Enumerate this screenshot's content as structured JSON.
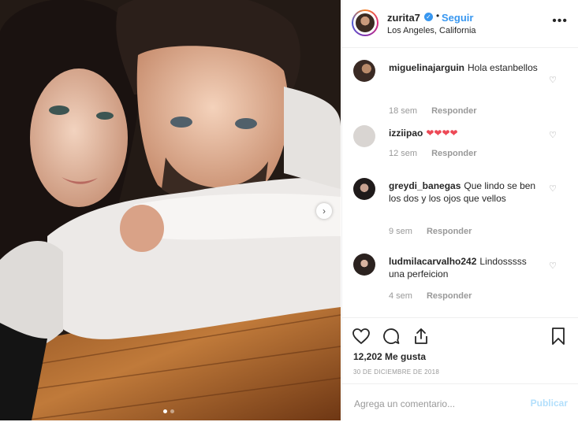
{
  "post": {
    "username": "zurita7",
    "follow_label": "Seguir",
    "separator": "•",
    "location": "Los Angeles, California",
    "more_label": "•••",
    "verified_mark": "✓"
  },
  "carousel": {
    "next_label": "›",
    "dots": 2,
    "active_dot": 1
  },
  "comments": [
    {
      "user": "miguelinajarguin",
      "text": "Hola estanbellos",
      "time": "18 sem",
      "reply": "Responder"
    },
    {
      "user": "izziipao",
      "text": "❤❤❤❤",
      "time": "12 sem",
      "reply": "Responder"
    },
    {
      "user": "greydi_banegas",
      "text": "Que lindo se ben los dos y los ojos que vellos",
      "time": "9 sem",
      "reply": "Responder"
    },
    {
      "user": "ludmilacarvalho242",
      "text": "Lindosssss una perfeicion",
      "time": "4 sem",
      "reply": "Responder"
    }
  ],
  "like_heart": "♡",
  "actions": {
    "likes": "12,202 Me gusta",
    "date": "30 DE DICIEMBRE DE 2018"
  },
  "add_comment": {
    "placeholder": "Agrega un comentario...",
    "publish_label": "Publicar"
  },
  "colors": {
    "accent": "#3897f0",
    "publish_disabled": "#b2dffc",
    "heart_red": "#ed4956"
  },
  "icons": [
    "heart-icon",
    "comment-icon",
    "share-icon",
    "bookmark-icon",
    "more-icon",
    "chevron-right-icon",
    "verified-badge-icon"
  ]
}
